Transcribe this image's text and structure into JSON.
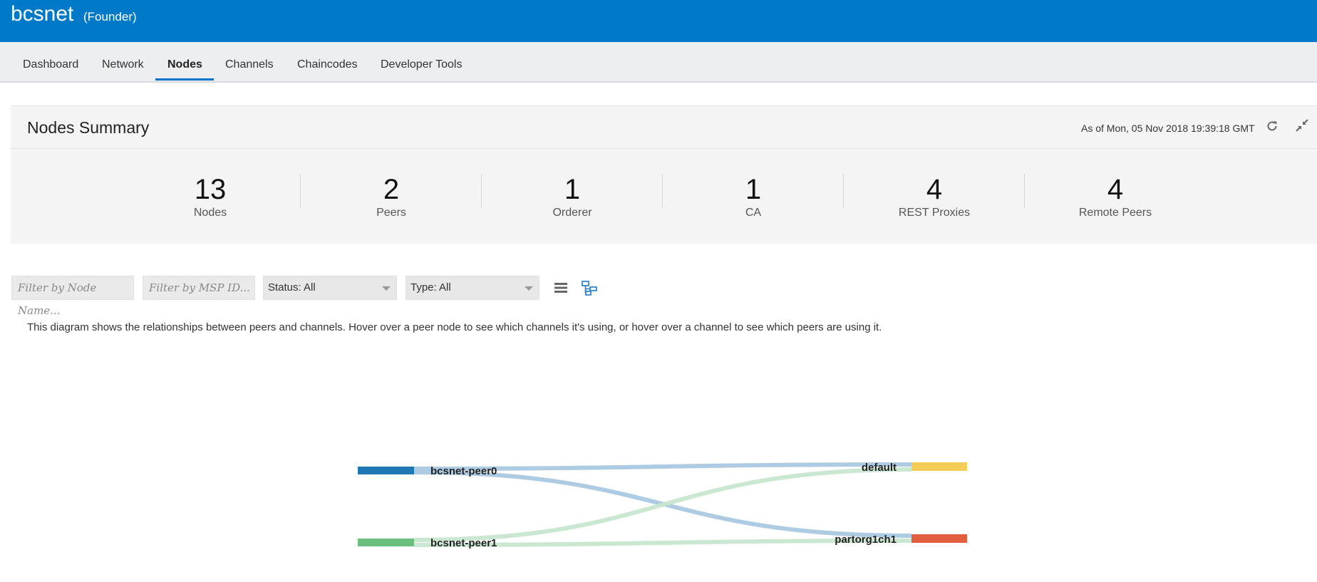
{
  "header": {
    "network_name": "bcsnet",
    "role": "(Founder)",
    "bg_color": "#0079c9"
  },
  "nav": {
    "tabs": [
      {
        "label": "Dashboard"
      },
      {
        "label": "Network"
      },
      {
        "label": "Nodes",
        "active": true
      },
      {
        "label": "Channels"
      },
      {
        "label": "Chaincodes"
      },
      {
        "label": "Developer Tools"
      }
    ]
  },
  "summary": {
    "title": "Nodes Summary",
    "as_of": "As of Mon, 05 Nov 2018 19:39:18 GMT",
    "stats": [
      {
        "value": "13",
        "label": "Nodes"
      },
      {
        "value": "2",
        "label": "Peers"
      },
      {
        "value": "1",
        "label": "Orderer"
      },
      {
        "value": "1",
        "label": "CA"
      },
      {
        "value": "4",
        "label": "REST Proxies"
      },
      {
        "value": "4",
        "label": "Remote Peers"
      }
    ],
    "icons": [
      "refresh-icon",
      "collapse-icon"
    ]
  },
  "filters": {
    "node_name_placeholder": "Filter by Node Name...",
    "msp_id_placeholder": "Filter by MSP ID...",
    "status_value": "Status: All",
    "type_value": "Type: All",
    "view_icons": [
      "list-view-icon",
      "topology-view-icon"
    ]
  },
  "description": "This diagram shows the relationships between peers and channels. Hover over a peer node to see which channels it's using, or hover over a channel to see which peers are using it.",
  "diagram": {
    "peers": [
      {
        "name": "bcsnet-peer0",
        "color": "#1f77b4"
      },
      {
        "name": "bcsnet-peer1",
        "color": "#6bbf7f"
      }
    ],
    "channels": [
      {
        "name": "default",
        "color": "#f5cc55"
      },
      {
        "name": "partorg1ch1",
        "color": "#e35d3f"
      }
    ],
    "links": [
      {
        "from": "bcsnet-peer0",
        "to": "default",
        "color": "#a9c8e0"
      },
      {
        "from": "bcsnet-peer0",
        "to": "partorg1ch1",
        "color": "#a9c8e0"
      },
      {
        "from": "bcsnet-peer1",
        "to": "default",
        "color": "#c7e6cf"
      },
      {
        "from": "bcsnet-peer1",
        "to": "partorg1ch1",
        "color": "#c7e6cf"
      }
    ]
  }
}
